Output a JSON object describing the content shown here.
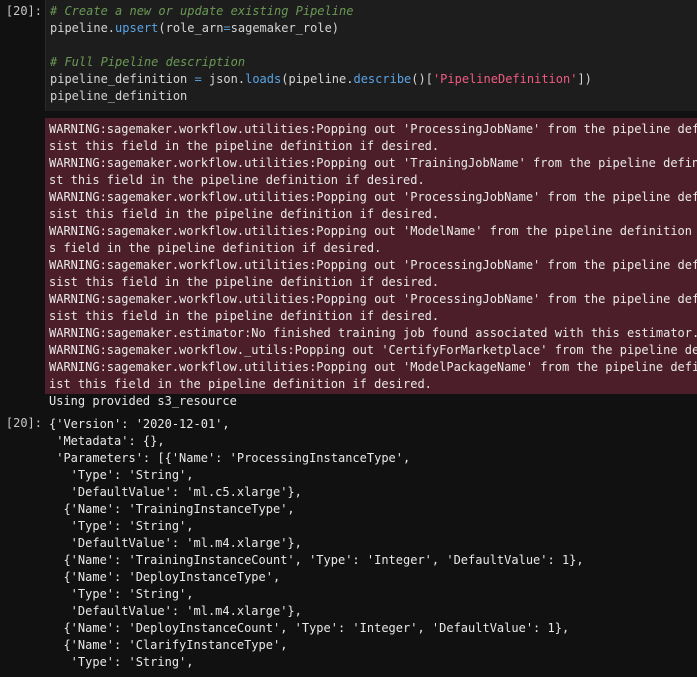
{
  "input_cell": {
    "prompt": "[20]:",
    "lines": [
      "# Create a new or update existing Pipeline",
      "pipeline.upsert(role_arn=sagemaker_role)",
      "",
      "# Full Pipeline description",
      "pipeline_definition = json.loads(pipeline.describe()['PipelineDefinition'])",
      "pipeline_definition"
    ],
    "tokens": {
      "l0": "# Create a new or update existing Pipeline",
      "l1a": "pipeline.",
      "l1b": "upsert",
      "l1c": "(role_arn",
      "l1d": "=",
      "l1e": "sagemaker_role)",
      "l3": "# Full Pipeline description",
      "l4a": "pipeline_definition ",
      "l4b": "=",
      "l4c": " json.",
      "l4d": "loads",
      "l4e": "(pipeline.",
      "l4f": "describe",
      "l4g": "()[",
      "l4h": "'PipelineDefinition'",
      "l4i": "])",
      "l5": "pipeline_definition"
    }
  },
  "stderr_output": [
    "WARNING:sagemaker.workflow.utilities:Popping out 'ProcessingJobName' from the pipeline defi",
    "sist this field in the pipeline definition if desired.",
    "WARNING:sagemaker.workflow.utilities:Popping out 'TrainingJobName' from the pipeline defini",
    "st this field in the pipeline definition if desired.",
    "WARNING:sagemaker.workflow.utilities:Popping out 'ProcessingJobName' from the pipeline defi",
    "sist this field in the pipeline definition if desired.",
    "WARNING:sagemaker.workflow.utilities:Popping out 'ModelName' from the pipeline definition b",
    "s field in the pipeline definition if desired.",
    "WARNING:sagemaker.workflow.utilities:Popping out 'ProcessingJobName' from the pipeline defi",
    "sist this field in the pipeline definition if desired.",
    "WARNING:sagemaker.workflow.utilities:Popping out 'ProcessingJobName' from the pipeline defi",
    "sist this field in the pipeline definition if desired.",
    "WARNING:sagemaker.estimator:No finished training job found associated with this estimator.",
    "WARNING:sagemaker.workflow._utils:Popping out 'CertifyForMarketplace' from the pipeline def",
    "WARNING:sagemaker.workflow.utilities:Popping out 'ModelPackageName' from the pipeline defin",
    "ist this field in the pipeline definition if desired."
  ],
  "stdout_output": "Using provided s3_resource",
  "result_cell": {
    "prompt": "[20]:",
    "lines": [
      "{'Version': '2020-12-01',",
      " 'Metadata': {},",
      " 'Parameters': [{'Name': 'ProcessingInstanceType',",
      "   'Type': 'String',",
      "   'DefaultValue': 'ml.c5.xlarge'},",
      "  {'Name': 'TrainingInstanceType',",
      "   'Type': 'String',",
      "   'DefaultValue': 'ml.m4.xlarge'},",
      "  {'Name': 'TrainingInstanceCount', 'Type': 'Integer', 'DefaultValue': 1},",
      "  {'Name': 'DeployInstanceType',",
      "   'Type': 'String',",
      "   'DefaultValue': 'ml.m4.xlarge'},",
      "  {'Name': 'DeployInstanceCount', 'Type': 'Integer', 'DefaultValue': 1},",
      "  {'Name': 'ClarifyInstanceType',",
      "   'Type': 'String',"
    ]
  }
}
